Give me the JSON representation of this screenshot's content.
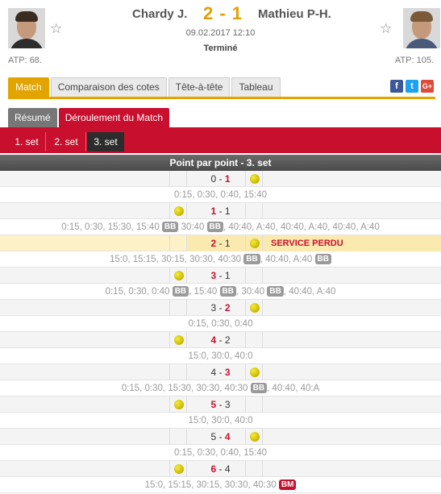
{
  "header": {
    "player1": "Chardy J.",
    "player2": "Mathieu P-H.",
    "score": "2 - 1",
    "date": "09.02.2017 12:10",
    "status": "Terminé",
    "atp1": "ATP: 68.",
    "atp2": "ATP: 105."
  },
  "main_tabs": [
    "Match",
    "Comparaison des cotes",
    "Tête-à-tête",
    "Tableau"
  ],
  "social": {
    "fb": "f",
    "tw": "t",
    "gp": "G+"
  },
  "sub_tabs": [
    "Résumé",
    "Déroulement du Match"
  ],
  "set_tabs": [
    "1. set",
    "2. set",
    "3. set"
  ],
  "table_title": "Point par point - 3. set",
  "rows": [
    {
      "kind": "score",
      "left": "0",
      "right": "1",
      "winner": "right",
      "server": "B",
      "note": ""
    },
    {
      "kind": "seq",
      "parts": [
        {
          "t": "0:15, 0:30, 0:40, 15:40"
        }
      ]
    },
    {
      "kind": "score",
      "left": "1",
      "right": "1",
      "winner": "left",
      "server": "A",
      "note": ""
    },
    {
      "kind": "seq",
      "parts": [
        {
          "t": "0:15, 0:30, 15:30, 15:40 "
        },
        {
          "tag": "BB"
        },
        {
          "t": " 30:40 "
        },
        {
          "tag": "BB"
        },
        {
          "t": ", 40:40, A:40, 40:40, A:40, 40:40, A:40"
        }
      ]
    },
    {
      "kind": "score",
      "left": "2",
      "right": "1",
      "winner": "left",
      "server": "B",
      "note": "SERVICE PERDU",
      "highlight": true
    },
    {
      "kind": "seq",
      "parts": [
        {
          "t": "15:0, 15:15, 30:15, 30:30, 40:30 "
        },
        {
          "tag": "BB"
        },
        {
          "t": ", 40:40, A:40 "
        },
        {
          "tag": "BB"
        }
      ]
    },
    {
      "kind": "score",
      "left": "3",
      "right": "1",
      "winner": "left",
      "server": "A",
      "note": ""
    },
    {
      "kind": "seq",
      "parts": [
        {
          "t": "0:15, 0:30, 0:40 "
        },
        {
          "tag": "BB"
        },
        {
          "t": ", 15:40 "
        },
        {
          "tag": "BB"
        },
        {
          "t": ", 30:40 "
        },
        {
          "tag": "BB"
        },
        {
          "t": ", 40:40, A:40"
        }
      ]
    },
    {
      "kind": "score",
      "left": "3",
      "right": "2",
      "winner": "right",
      "server": "B",
      "note": ""
    },
    {
      "kind": "seq",
      "parts": [
        {
          "t": "0:15, 0:30, 0:40"
        }
      ]
    },
    {
      "kind": "score",
      "left": "4",
      "right": "2",
      "winner": "left",
      "server": "A",
      "note": ""
    },
    {
      "kind": "seq",
      "parts": [
        {
          "t": "15:0, 30:0, 40:0"
        }
      ]
    },
    {
      "kind": "score",
      "left": "4",
      "right": "3",
      "winner": "right",
      "server": "B",
      "note": ""
    },
    {
      "kind": "seq",
      "parts": [
        {
          "t": "0:15, 0:30, 15:30, 30:30, 40:30 "
        },
        {
          "tag": "BB"
        },
        {
          "t": ", 40:40, 40:A"
        }
      ]
    },
    {
      "kind": "score",
      "left": "5",
      "right": "3",
      "winner": "left",
      "server": "A",
      "note": ""
    },
    {
      "kind": "seq",
      "parts": [
        {
          "t": "15:0, 30:0, 40:0"
        }
      ]
    },
    {
      "kind": "score",
      "left": "5",
      "right": "4",
      "winner": "right",
      "server": "B",
      "note": ""
    },
    {
      "kind": "seq",
      "parts": [
        {
          "t": "0:15, 0:30, 0:40, 15:40"
        }
      ]
    },
    {
      "kind": "score",
      "left": "6",
      "right": "4",
      "winner": "left",
      "server": "A",
      "note": ""
    },
    {
      "kind": "seq",
      "parts": [
        {
          "t": "15:0, 15:15, 30:15, 30:30, 40:30 "
        },
        {
          "tag": "BM"
        }
      ]
    }
  ]
}
